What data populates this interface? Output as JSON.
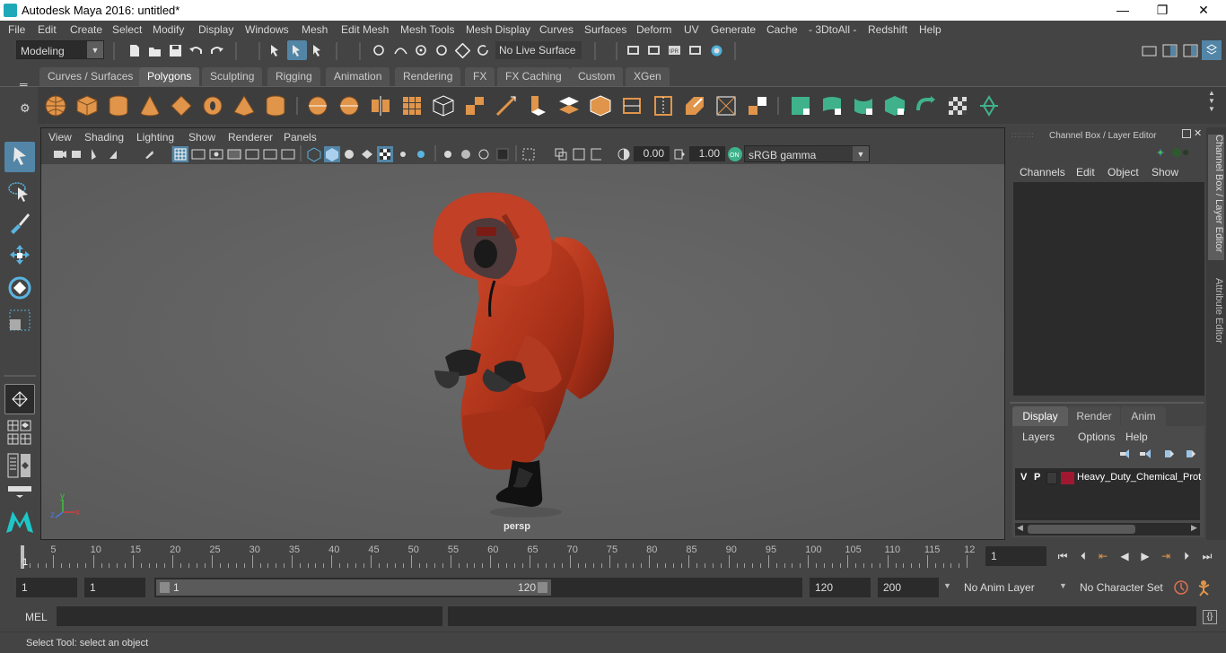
{
  "window": {
    "title": "Autodesk Maya 2016: untitled*",
    "minimize": "—",
    "maximize": "❐",
    "close": "✕"
  },
  "menubar": [
    "File",
    "Edit",
    "Create",
    "Select",
    "Modify",
    "Display",
    "Windows",
    "Mesh",
    "Edit Mesh",
    "Mesh Tools",
    "Mesh Display",
    "Curves",
    "Surfaces",
    "Deform",
    "UV",
    "Generate",
    "Cache",
    "- 3DtoAll -",
    "Redshift",
    "Help"
  ],
  "statusline": {
    "mode": "Modeling",
    "live_surface": "No Live Surface"
  },
  "shelf_tabs": [
    {
      "label": "Curves / Surfaces",
      "active": false
    },
    {
      "label": "Polygons",
      "active": true
    },
    {
      "label": "Sculpting",
      "active": false
    },
    {
      "label": "Rigging",
      "active": false
    },
    {
      "label": "Animation",
      "active": false
    },
    {
      "label": "Rendering",
      "active": false
    },
    {
      "label": "FX",
      "active": false
    },
    {
      "label": "FX Caching",
      "active": false
    },
    {
      "label": "Custom",
      "active": false
    },
    {
      "label": "XGen",
      "active": false
    }
  ],
  "panel_menus": [
    "View",
    "Shading",
    "Lighting",
    "Show",
    "Renderer",
    "Panels"
  ],
  "panel_toolbar": {
    "exposure": "0.00",
    "gamma": "1.00",
    "color_space": "sRGB gamma"
  },
  "viewport": {
    "camera_label": "persp",
    "axis_y": "y",
    "axis_x": "x",
    "axis_z": "z"
  },
  "channel_box": {
    "title": "Channel Box / Layer Editor",
    "menus": [
      "Channels",
      "Edit",
      "Object",
      "Show"
    ]
  },
  "layer_editor": {
    "tabs": [
      "Display",
      "Render",
      "Anim"
    ],
    "active_tab": "Display",
    "menus": [
      "Layers",
      "Options",
      "Help"
    ],
    "layers": [
      {
        "v": "V",
        "p": "P",
        "name": "Heavy_Duty_Chemical_Prot",
        "color": "#a01830"
      }
    ]
  },
  "side_tabs": [
    "Channel Box / Layer Editor",
    "Attribute Editor"
  ],
  "timeline": {
    "ticks": [
      "5",
      "10",
      "15",
      "20",
      "25",
      "30",
      "35",
      "40",
      "45",
      "50",
      "55",
      "60",
      "65",
      "70",
      "75",
      "80",
      "85",
      "90",
      "95",
      "100",
      "105",
      "110",
      "115",
      "12"
    ],
    "start_marker": "1",
    "current_frame": "1"
  },
  "range": {
    "start": "1",
    "playback_start": "1",
    "slider_start": "1",
    "slider_end": "120",
    "playback_end": "120",
    "end": "200",
    "anim_layer": "No Anim Layer",
    "character_set": "No Character Set"
  },
  "mel": {
    "label": "MEL"
  },
  "helpline": {
    "text": "Select Tool: select an object"
  },
  "colors": {
    "accent": "#5285a6",
    "poly_orange": "#e0954a",
    "teal": "#3fb28c",
    "suit_red": "#b83a22"
  }
}
